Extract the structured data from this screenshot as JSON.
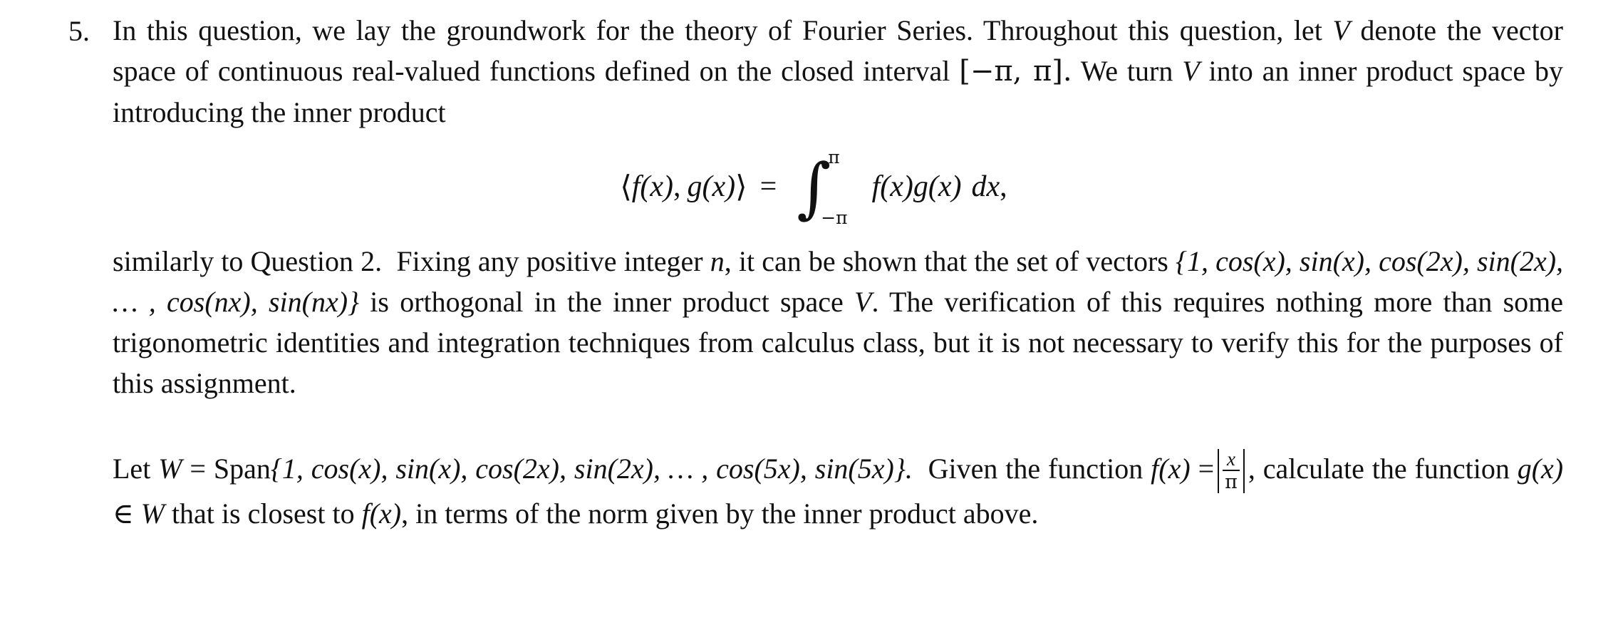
{
  "document": {
    "type": "math-assignment-question",
    "question_number": "5.",
    "paragraph1": {
      "line1": "In this question, we lay the groundwork for the theory of Fourier Series. Throughout this question, let",
      "line2_prefix": "",
      "text": "In this question, we lay the groundwork for the theory of Fourier Series. Throughout this question, let V denote the vector space of continuous real-valued functions defined on the closed interval [−π, π]. We turn V into an inner product space by introducing the inner product",
      "seg1": "In this question, we lay the groundwork for the theory of Fourier Series. Throughout this question, let",
      "var_V_1": "V",
      "seg2": "denote the vector space of continuous real-valued functions defined on the closed interval",
      "interval": "[−π, π].",
      "seg3": "We turn",
      "var_V_2": "V",
      "seg4": "into an inner product space by introducing the inner product"
    },
    "display_equation": {
      "latex": "\\langle f(x), g(x)\\rangle = \\int_{-\\pi}^{\\pi} f(x)g(x)\\,dx,",
      "lhs_open_angle": "⟨",
      "lhs_f": "f",
      "lhs_fx": "(x)",
      "lhs_comma": ",",
      "lhs_g": "g",
      "lhs_gx": "(x)",
      "lhs_close_angle": "⟩",
      "equals": "=",
      "integral_sign": "∫",
      "upper_limit": "π",
      "lower_limit": "−π",
      "integrand": "f(x)g(x)",
      "differential": "dx",
      "trailing_punctuation": ","
    },
    "paragraph2": {
      "text": "similarly to Question 2. Fixing any positive integer n, it can be shown that the set of vectors {1, cos(x), sin(x), cos(2x), sin(2x), …, cos(nx), sin(nx)} is orthogonal in the inner product space V. The verification of this requires nothing more than some trigonometric identities and integration techniques from calculus class, but it is not necessary to verify this for the purposes of this assignment.",
      "seg1": "similarly to Question 2.",
      "seg2": "Fixing any positive integer",
      "var_n": "n",
      "seg3": ", it can be shown that the set of vectors",
      "set_open": "{1, cos(",
      "set_notation": "{1, cos(x), sin(x), cos(2x), sin(2x), … , cos(nx), sin(nx)}",
      "seg4": "is orthogonal in the inner product space",
      "var_V": "V",
      "seg5": ".",
      "seg6": "The verification of this requires nothing more than some trigonometric identities and integration techniques from calculus class, but it is not necessary to verify this for the purposes of this assignment."
    },
    "paragraph3": {
      "text": "Let W = Span{1, cos(x), sin(x), cos(2x), sin(2x), …, cos(5x), sin(5x)}. Given the function f(x) = |x/π|, calculate the function g(x) ∈ W that is closest to f(x), in terms of the norm given by the inner product above.",
      "seg_let": "Let",
      "var_W": "W",
      "equals": "=",
      "span_label": "Span",
      "span_set": "{1, cos(x), sin(x), cos(2x), sin(2x), … , cos(5x), sin(5x)}.",
      "seg_given": "Given the function",
      "fx_label": "f(x)",
      "fx_equals": "=",
      "fx_numerator": "x",
      "fx_denominator": "π",
      "fx_trailing": ",",
      "seg_calculate": "calculate the function",
      "gx_label": "g(x)",
      "member_symbol": "∈",
      "var_W2": "W",
      "seg_closest": "that is closest to",
      "fx_label2": "f(x)",
      "seg_norm": ", in terms of the norm given by the inner product",
      "seg_above": "above."
    },
    "colors": {
      "text": "#111111",
      "background": "#ffffff"
    }
  }
}
